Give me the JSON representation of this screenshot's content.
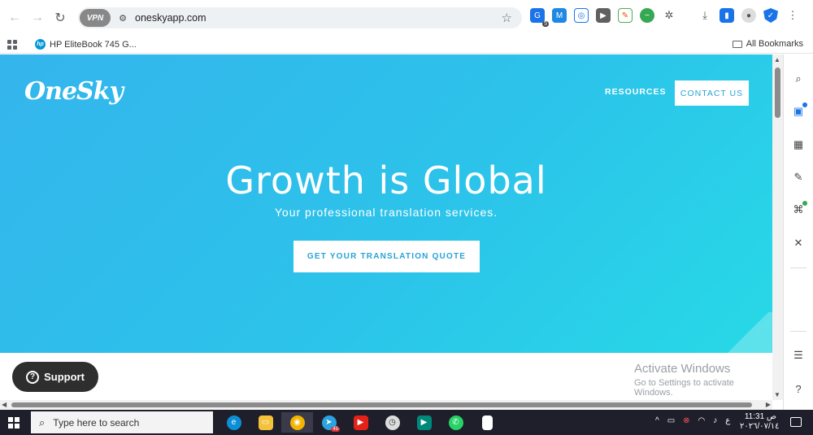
{
  "browser": {
    "vpn_label": "VPN",
    "url": "oneskyapp.com",
    "bookmark_item": "HP EliteBook 745 G...",
    "all_bookmarks": "All Bookmarks",
    "extension_badge": "5"
  },
  "site": {
    "logo": "OneSky",
    "nav": {
      "resources": "RESOURCES",
      "contact": "CONTACT US"
    },
    "hero": {
      "headline": "Growth is Global",
      "subline": "Your professional translation services.",
      "cta": "GET YOUR TRANSLATION QUOTE"
    },
    "support": "Support"
  },
  "overlay": {
    "activate_title": "Activate Windows",
    "activate_sub": "Go to Settings to activate Windows."
  },
  "taskbar": {
    "search_placeholder": "Type here to search",
    "telegram_badge": "45",
    "time": "11:31 ص",
    "date": "٢٠٢٦/٠٧/١٤",
    "lang": "ع"
  },
  "colors": {
    "hero_start": "#34b5ec",
    "hero_end": "#27d9e6",
    "cta_text": "#27a3d8"
  }
}
